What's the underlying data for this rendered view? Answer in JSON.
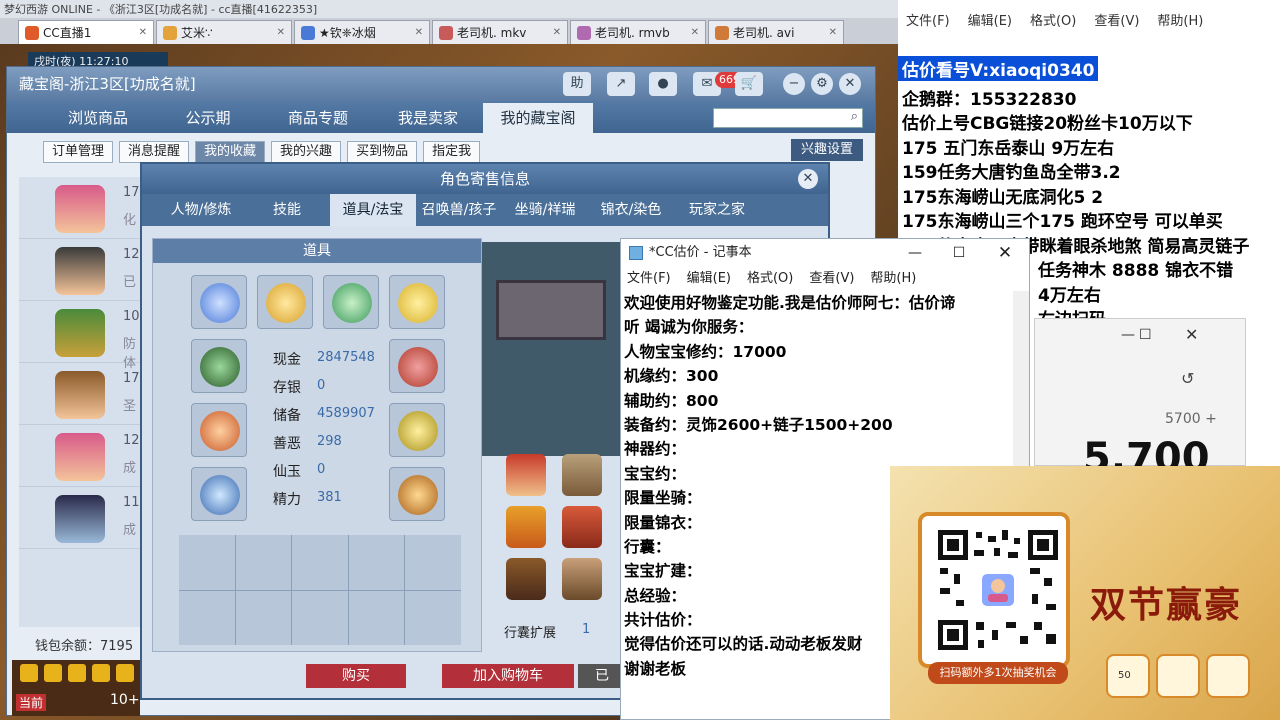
{
  "taskbar": {
    "text": "梦幻西游 ONLINE  - 《浙江3区[功成名就]  - cc直播[41622353]"
  },
  "tabs": [
    {
      "label": "CC直播1",
      "active": true
    },
    {
      "label": "艾米∵",
      "active": false
    },
    {
      "label": "★钦❈冰烟",
      "active": false
    },
    {
      "label": "老司机. mkv",
      "active": false
    },
    {
      "label": "老司机. rmvb",
      "active": false
    },
    {
      "label": "老司机. avi",
      "active": false
    }
  ],
  "game": {
    "clock": "戌时(夜)  11:27:10"
  },
  "cbg": {
    "title": "藏宝阁-浙江3区[功成名就]",
    "help_label": "助",
    "cart_count": "669",
    "nav": [
      "浏览商品",
      "公示期",
      "商品专题",
      "我是卖家",
      "我的藏宝阁"
    ],
    "subnav": [
      "订单管理",
      "消息提醒",
      "我的收藏",
      "我的兴趣",
      "买到物品",
      "指定我"
    ],
    "interest_label": "兴趣设置",
    "chars": [
      {
        "lv": "175",
        "sub": "化"
      },
      {
        "lv": "129",
        "sub": "已"
      },
      {
        "lv": "109",
        "sub": "防\n体"
      },
      {
        "lv": "175",
        "sub": "圣"
      },
      {
        "lv": "129",
        "sub": "成"
      },
      {
        "lv": "119",
        "sub": "成"
      }
    ],
    "wallet": "钱包余额：7195"
  },
  "role": {
    "title": "角色寄售信息",
    "tabs": [
      "人物/修炼",
      "技能",
      "道具/法宝",
      "召唤兽/孩子",
      "坐骑/祥瑞",
      "锦衣/染色",
      "玩家之家"
    ],
    "items_header": "道具",
    "stats": [
      {
        "label": "现金",
        "value": "2847548"
      },
      {
        "label": "存银",
        "value": "0"
      },
      {
        "label": "储备",
        "value": "4589907"
      },
      {
        "label": "善恶",
        "value": "298"
      },
      {
        "label": "仙玉",
        "value": "0"
      },
      {
        "label": "精力",
        "value": "381"
      }
    ],
    "expand_label": "行囊扩展",
    "expand_value": "1",
    "buy_label": "购买",
    "cart_label": "加入购物车",
    "sold_label": "已"
  },
  "game_bottom": {
    "current": "当前",
    "ten_plus": "10+"
  },
  "bg_notepad": {
    "menu": [
      "文件(F)",
      "编辑(E)",
      "格式(O)",
      "查看(V)",
      "帮助(H)"
    ],
    "lines": [
      "估价看号V:xiaoqi0340",
      "企鹅群：155322830",
      "估价上号CBG链接20粉丝卡10万以下",
      "175 五门东岳泰山  9万左右",
      "159任务大唐钓鱼岛全带3.2",
      "175东海崂山无底洞化5  2",
      "175东海崂山三个175 跑环空号 可以单买",
      "109仙鬼魔王全带眯着眼杀地煞 简易高灵链子",
      "任务神木 8888 锦衣不错",
      "4万左右",
      "右边扫码"
    ],
    "watermark": "CC直播"
  },
  "calc": {
    "min": "—",
    "max": "☐",
    "close": "✕",
    "history": "↺",
    "expr": "5700 +",
    "result": "5,700"
  },
  "notepad": {
    "title": "*CC估价 - 记事本",
    "min": "—",
    "max": "☐",
    "close": "✕",
    "menu": [
      "文件(F)",
      "编辑(E)",
      "格式(O)",
      "查看(V)",
      "帮助(H)"
    ],
    "lines": [
      "欢迎使用好物鉴定功能.我是估价师阿七：估价谛",
      "听 竭诚为你服务：",
      "人物宝宝修约：17000",
      "机缘约：300",
      "辅助约：800",
      "装备约：灵饰2600+链子1500+200",
      "神器约：",
      "宝宝约：",
      "限量坐骑：",
      "限量锦衣：",
      "行囊：",
      "宝宝扩建：",
      "总经验：",
      "共计估价：",
      "觉得估价还可以的话.动动老板发财",
      "谢谢老板"
    ]
  },
  "ad": {
    "qr_banner": "扫码额外多1次抽奖机会",
    "slogan": "双节赢豪",
    "item_count": "50"
  }
}
